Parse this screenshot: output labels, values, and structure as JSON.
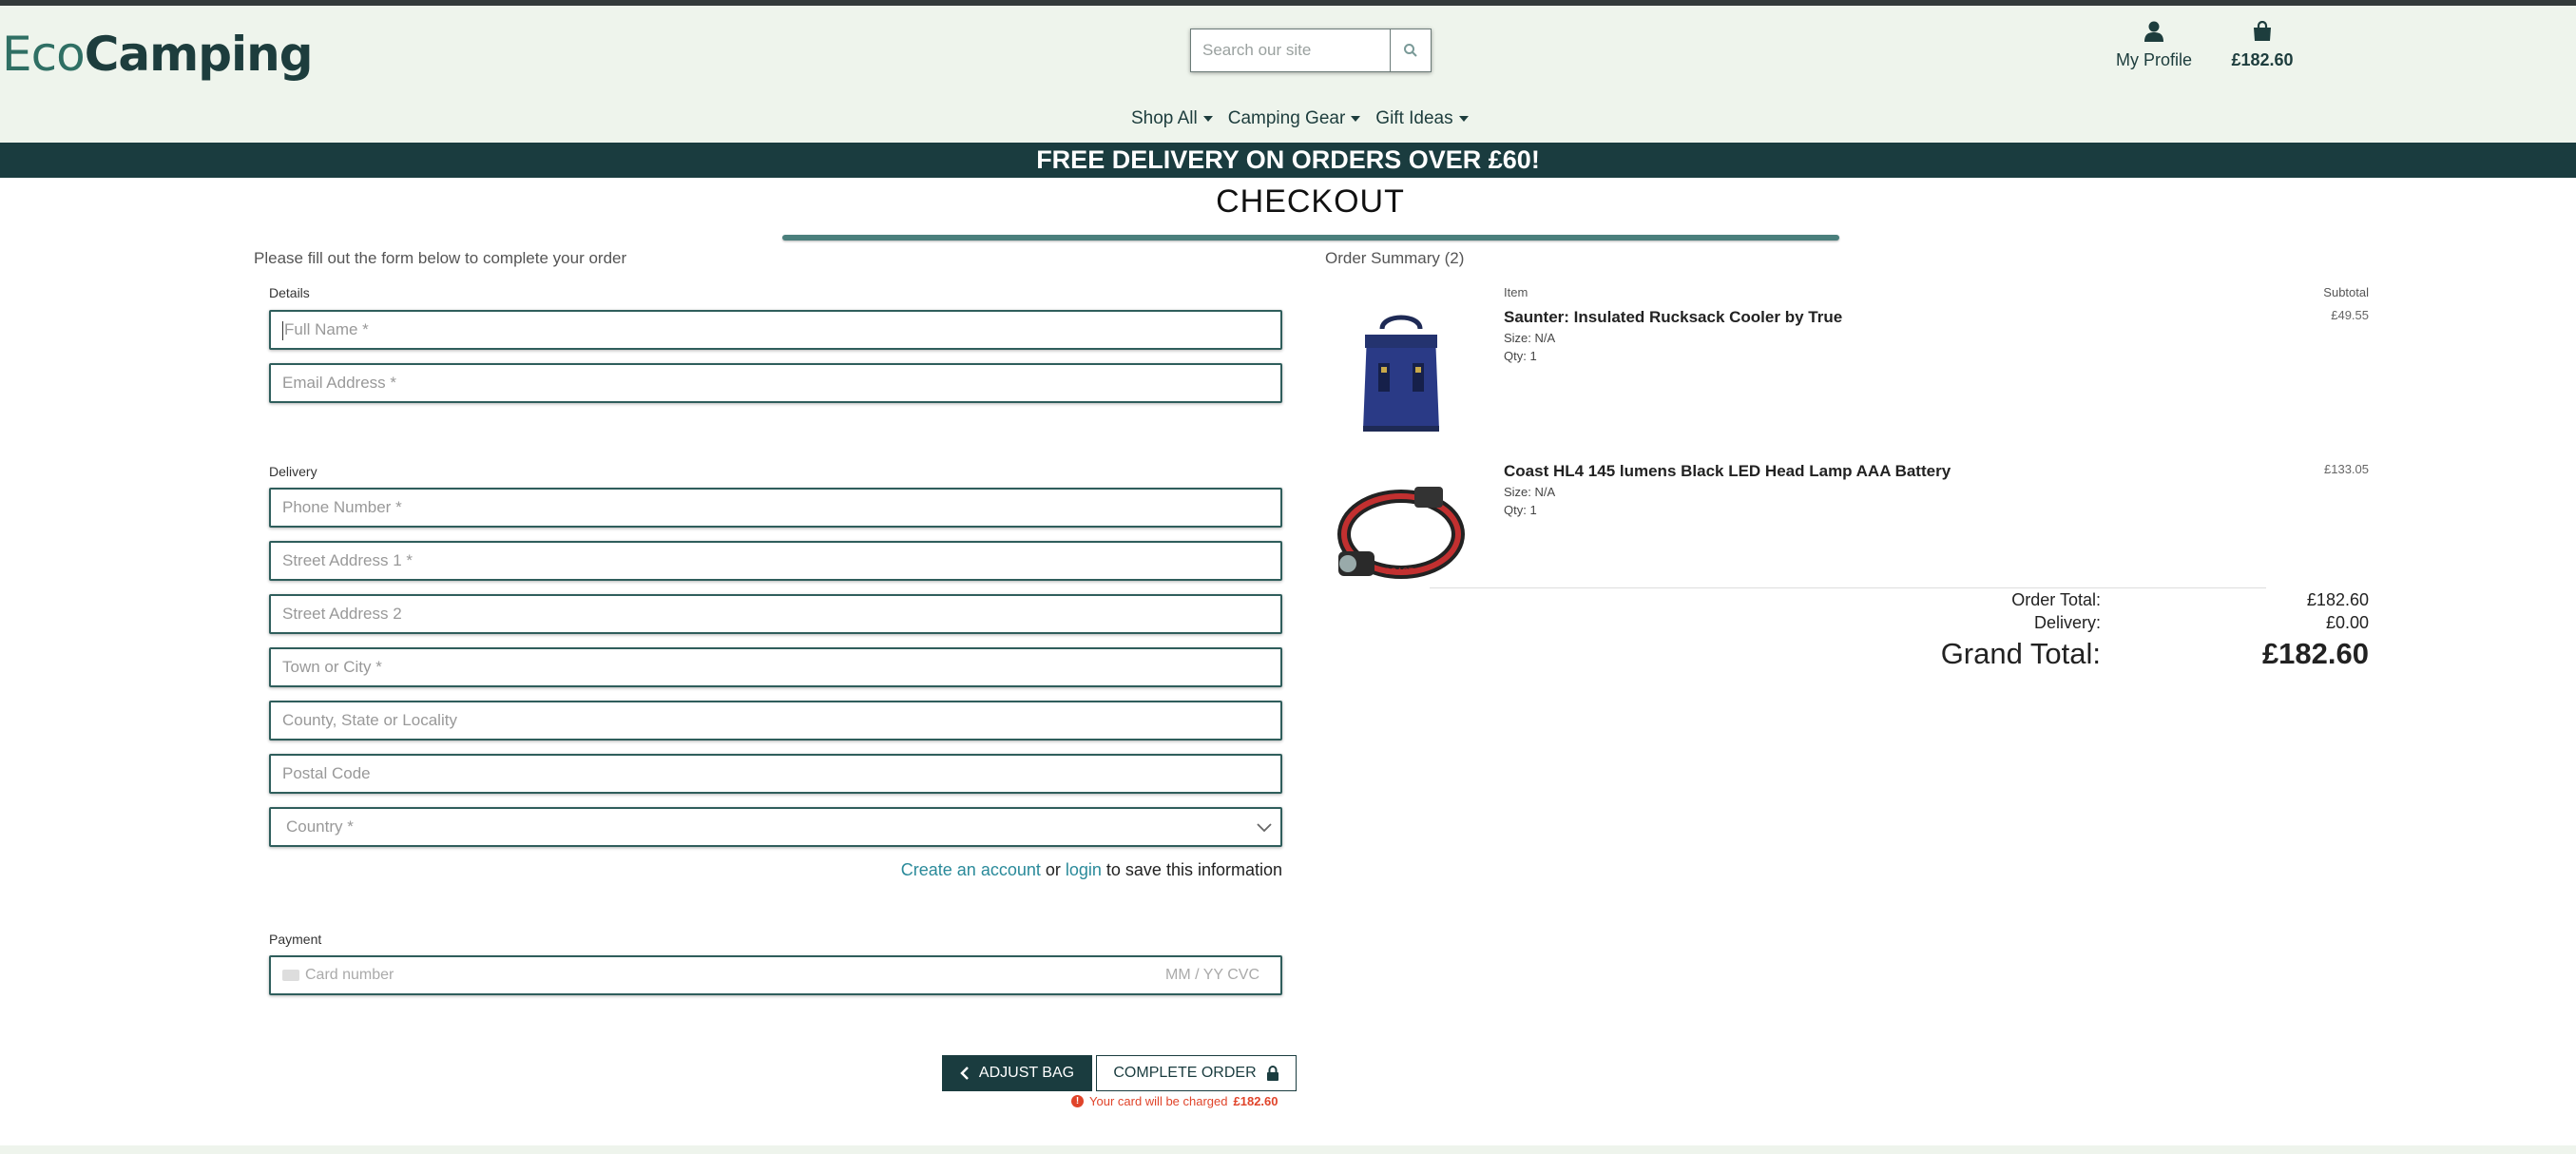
{
  "header": {
    "logo_eco": "Eco",
    "logo_camping": "Camping",
    "search_placeholder": "Search our site",
    "profile_label": "My Profile",
    "bag_total": "£182.60"
  },
  "nav": {
    "items": [
      "Shop All",
      "Camping Gear",
      "Gift Ideas"
    ]
  },
  "banner": "FREE DELIVERY ON ORDERS OVER £60!",
  "page_title": "CHECKOUT",
  "form": {
    "intro": "Please fill out the form below to complete your order",
    "details_label": "Details",
    "full_name": "Full Name *",
    "email": "Email Address *",
    "delivery_label": "Delivery",
    "phone": "Phone Number *",
    "street1": "Street Address 1 *",
    "street2": "Street Address 2",
    "town": "Town or City *",
    "county": "County, State or Locality",
    "postcode": "Postal Code",
    "country": "Country *",
    "create_account": "Create an account",
    "or": " or ",
    "login": "login",
    "save_info": " to save this information",
    "payment_label": "Payment",
    "card_number": "Card number",
    "card_exp_cvc": "MM / YY  CVC",
    "adjust_bag": "ADJUST BAG",
    "complete_order": "COMPLETE ORDER",
    "charge_text": "Your card will be charged",
    "charge_amount": "£182.60"
  },
  "summary": {
    "heading": "Order Summary (2)",
    "col_item": "Item",
    "col_subtotal": "Subtotal",
    "items": [
      {
        "name": "Saunter: Insulated Rucksack Cooler by True",
        "size": "Size: N/A",
        "qty": "Qty: 1",
        "subtotal": "£49.55"
      },
      {
        "name": "Coast HL4 145 lumens Black LED Head Lamp AAA Battery",
        "size": "Size: N/A",
        "qty": "Qty: 1",
        "subtotal": "£133.05"
      }
    ],
    "order_total_label": "Order Total:",
    "order_total": "£182.60",
    "delivery_label": "Delivery:",
    "delivery": "£0.00",
    "grand_total_label": "Grand Total:",
    "grand_total": "£182.60"
  },
  "colors": {
    "brand_dark": "#1a3c3f",
    "brand_teal": "#2f6f64",
    "header_bg": "#eef4ec",
    "link": "#2a8a9a",
    "warning": "#e0442a"
  }
}
